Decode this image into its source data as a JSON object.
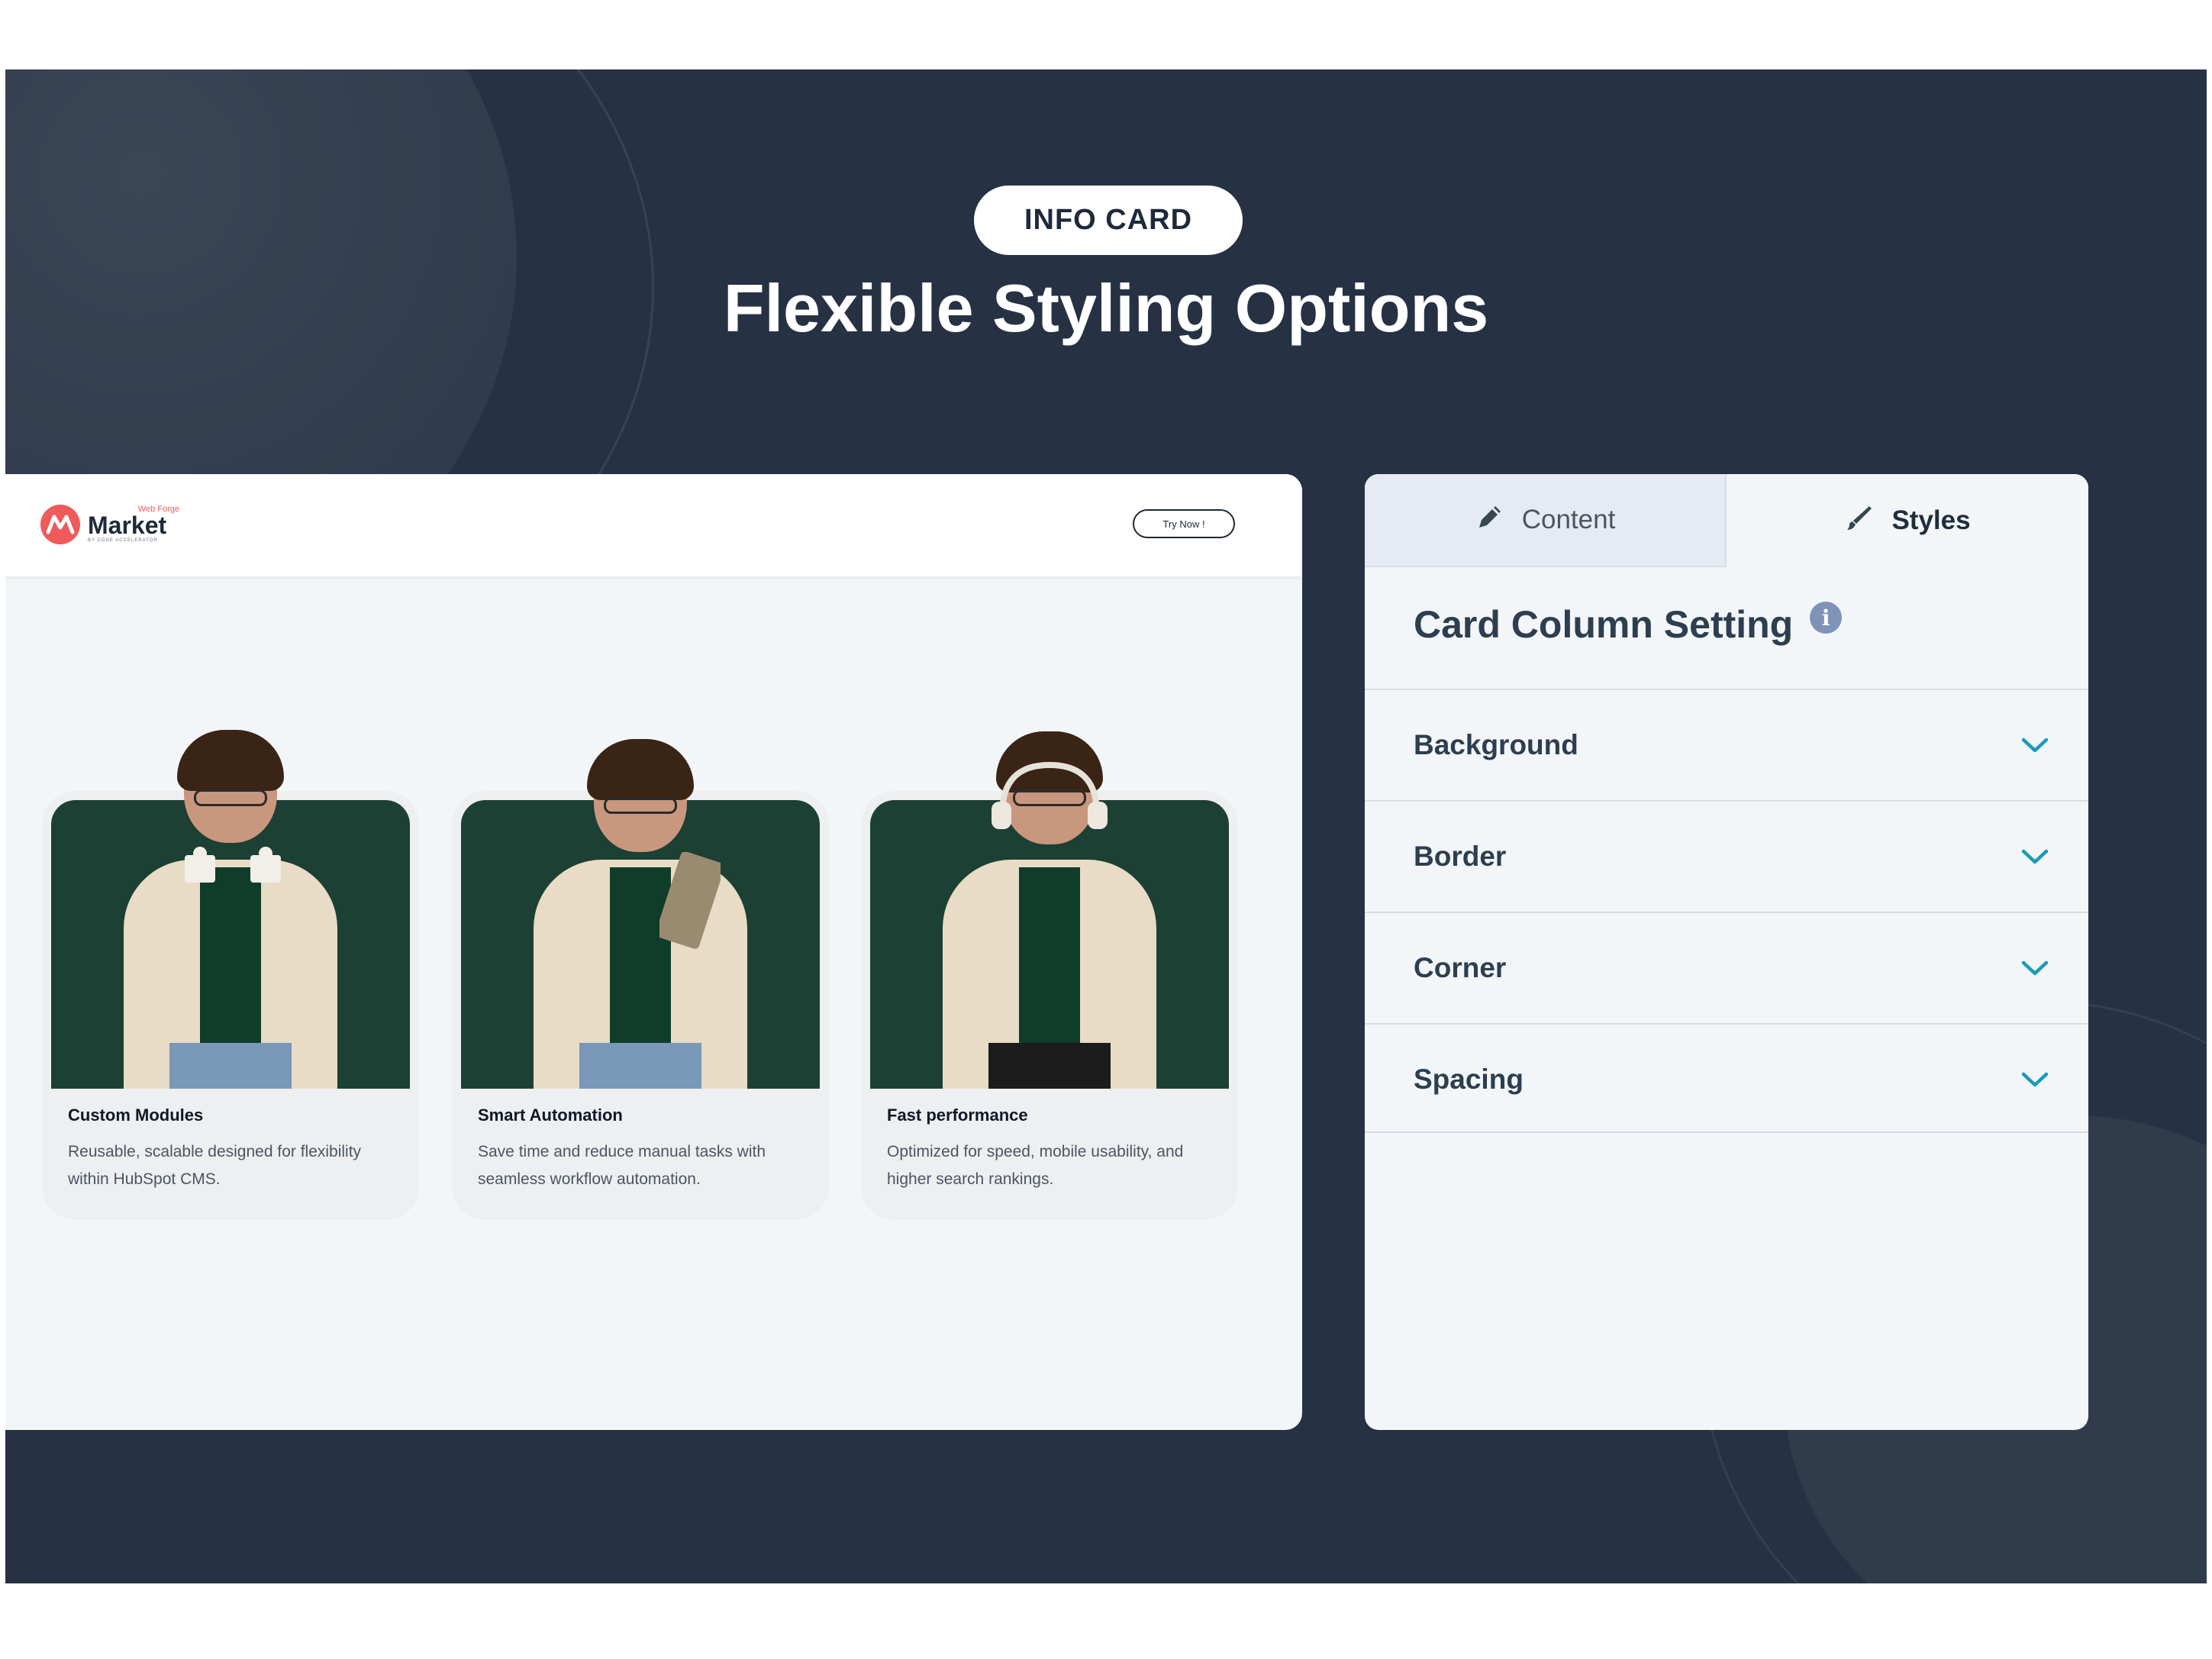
{
  "badge": "INFO CARD",
  "headline": "Flexible Styling Options",
  "preview": {
    "logo": {
      "top_text": "Web Forge",
      "name": "Market",
      "sub": "BY CODE ACCELERATOR",
      "icon": "market-logo-icon"
    },
    "try_button": "Try Now !",
    "cards": [
      {
        "title": "Custom Modules",
        "desc": "Reusable, scalable designed for flexibility within HubSpot CMS.",
        "image": "person-holding-puzzle-pieces",
        "bg_color": "#1c4034"
      },
      {
        "title": "Smart Automation",
        "desc": "Save time and reduce manual tasks with seamless workflow automation.",
        "image": "person-using-tablet",
        "bg_color": "#1c4034"
      },
      {
        "title": "Fast performance",
        "desc": "Optimized for speed, mobile usability, and higher search rankings.",
        "image": "person-wearing-headphones",
        "bg_color": "#1c4034"
      }
    ]
  },
  "settings": {
    "tabs": [
      {
        "label": "Content",
        "icon": "pencil-icon",
        "active": false
      },
      {
        "label": "Styles",
        "icon": "brush-icon",
        "active": true
      }
    ],
    "title": "Card Column Setting",
    "info_icon": "info-icon",
    "sections": [
      {
        "label": "Background"
      },
      {
        "label": "Border"
      },
      {
        "label": "Corner"
      },
      {
        "label": "Spacing"
      }
    ]
  },
  "colors": {
    "stage": "#263244",
    "accent_chevron": "#1a9bb6",
    "logo_red": "#ef5a5a"
  }
}
